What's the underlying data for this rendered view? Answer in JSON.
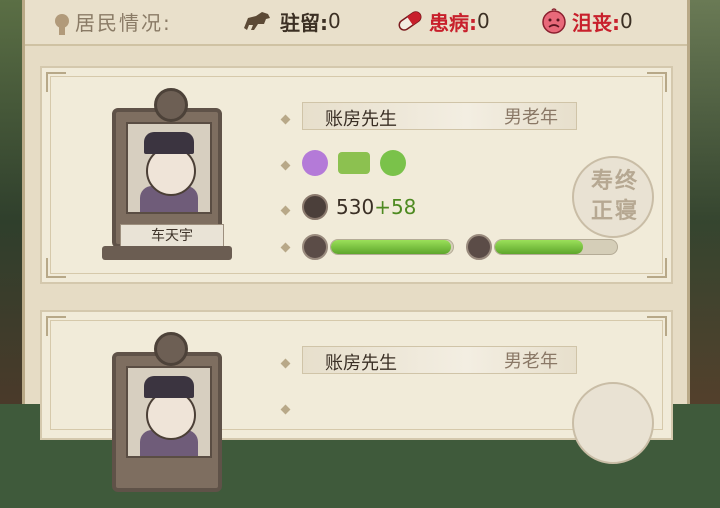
{
  "header": {
    "title": "居民情况:",
    "stay_label": "驻留:",
    "stay_value": "0",
    "sick_label": "患病:",
    "sick_value": "0",
    "depressed_label": "沮丧:",
    "depressed_value": "0"
  },
  "cards": [
    {
      "name": "账房先生",
      "type": "男老年",
      "character_name": "车天宇",
      "power_value": "530",
      "power_bonus": "+58",
      "health_progress": 0.98,
      "happiness_progress": 0.72,
      "seal_text": "寿终正寝"
    },
    {
      "name": "账房先生",
      "type": "男老年"
    }
  ],
  "colors": {
    "accent_green": "#5ea62b",
    "alert_red": "#c8202c",
    "panel_bg": "#e6dcc5"
  }
}
